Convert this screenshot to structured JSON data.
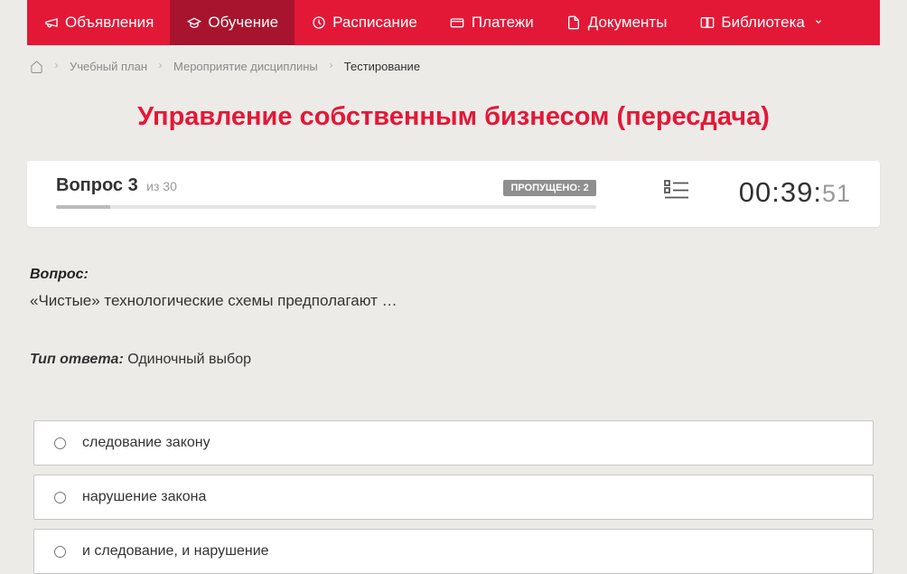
{
  "nav": {
    "items": [
      {
        "label": "Объявления",
        "icon": "megaphone"
      },
      {
        "label": "Обучение",
        "icon": "graduation",
        "active": true
      },
      {
        "label": "Расписание",
        "icon": "clock"
      },
      {
        "label": "Платежи",
        "icon": "card"
      },
      {
        "label": "Документы",
        "icon": "document"
      },
      {
        "label": "Библиотека",
        "icon": "book",
        "dropdown": true
      }
    ]
  },
  "breadcrumb": {
    "items": [
      {
        "label": "Учебный план"
      },
      {
        "label": "Мероприятие дисциплины"
      },
      {
        "label": "Тестирование",
        "current": true
      }
    ]
  },
  "page_title": "Управление собственным бизнесом (пересдача)",
  "status": {
    "question_label": "Вопрос 3",
    "question_of": "из 30",
    "skipped_label": "ПРОПУЩЕНО: 2",
    "timer_main": "00:39:",
    "timer_sec": "51"
  },
  "question": {
    "label": "Вопрос:",
    "text": "«Чистые» технологические схемы предполагают …",
    "answer_type_label": "Тип ответа:",
    "answer_type_value": "Одиночный выбор"
  },
  "options": [
    {
      "label": "следование закону"
    },
    {
      "label": "нарушение закона"
    },
    {
      "label": "и следование, и нарушение"
    }
  ]
}
